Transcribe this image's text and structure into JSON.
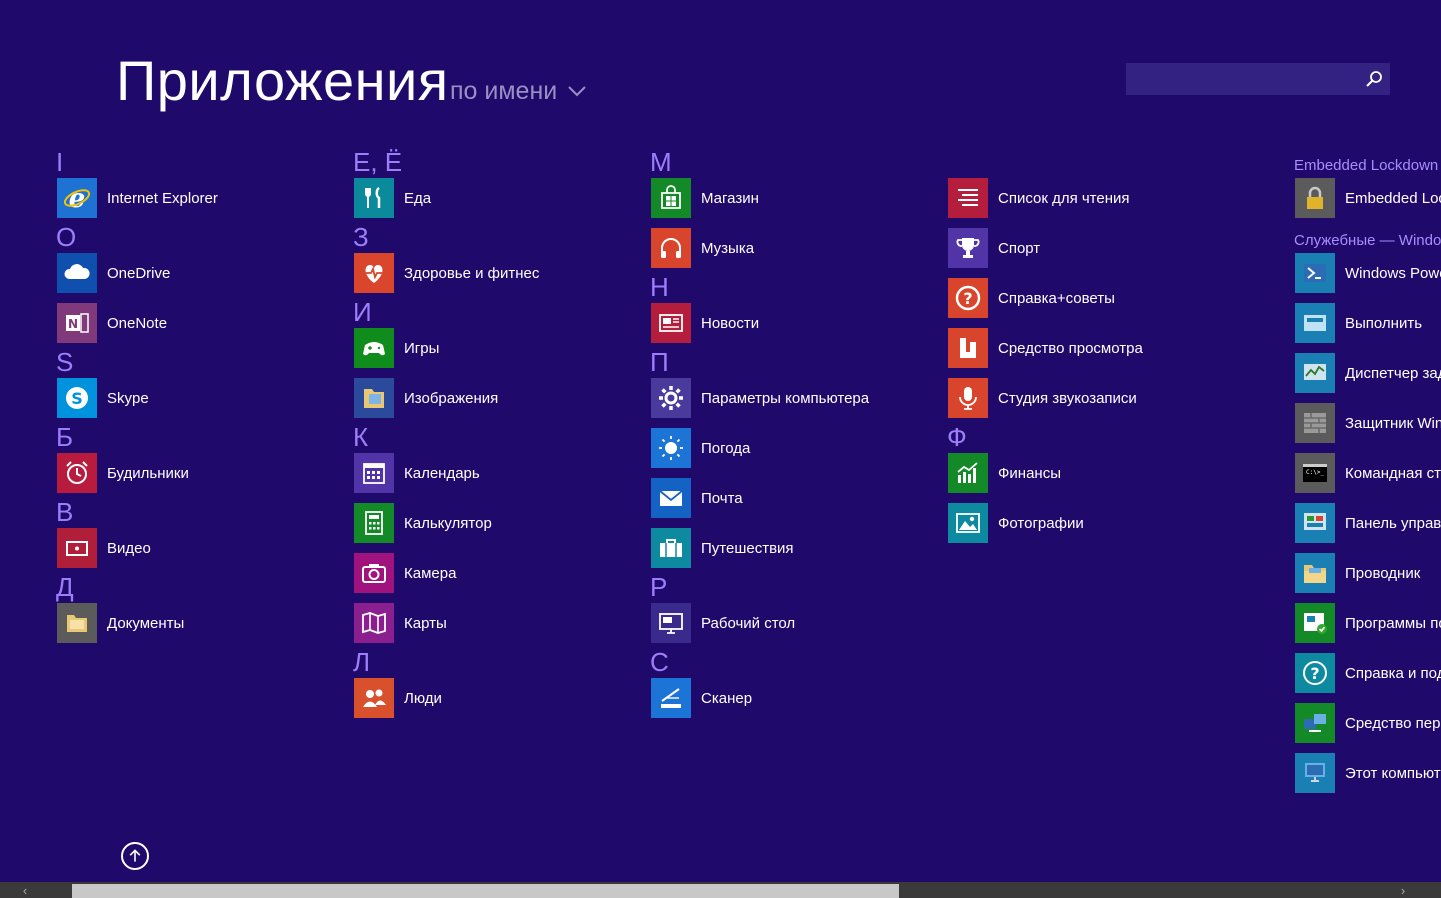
{
  "header": {
    "title": "Приложения",
    "sort_label": "по имени",
    "search_value": ""
  },
  "colors": {
    "background": "#1f0a6b",
    "letter": "#9c7dfa",
    "group_header": "#a98bff"
  },
  "columns": [
    {
      "sections": [
        {
          "letter": "I",
          "apps": [
            {
              "label": "Internet Explorer",
              "icon": "internet-explorer-icon",
              "color": "#1e72d3"
            }
          ]
        },
        {
          "letter": "O",
          "apps": [
            {
              "label": "OneDrive",
              "icon": "cloud-icon",
              "color": "#0f4fae"
            },
            {
              "label": "OneNote",
              "icon": "onenote-icon",
              "color": "#80397b"
            }
          ]
        },
        {
          "letter": "S",
          "apps": [
            {
              "label": "Skype",
              "icon": "skype-icon",
              "color": "#0092dd"
            }
          ]
        },
        {
          "letter": "Б",
          "apps": [
            {
              "label": "Будильники",
              "icon": "alarm-clock-icon",
              "color": "#b81b3e"
            }
          ]
        },
        {
          "letter": "В",
          "apps": [
            {
              "label": "Видео",
              "icon": "video-icon",
              "color": "#b01e3a"
            }
          ]
        },
        {
          "letter": "Д",
          "apps": [
            {
              "label": "Документы",
              "icon": "folder-icon",
              "color": "#5b5b5b"
            }
          ]
        }
      ]
    },
    {
      "sections": [
        {
          "letter": "Е, Ё",
          "apps": [
            {
              "label": "Еда",
              "icon": "fork-knife-icon",
              "color": "#0b8a9c"
            }
          ]
        },
        {
          "letter": "З",
          "apps": [
            {
              "label": "Здоровье и фитнес",
              "icon": "heart-pulse-icon",
              "color": "#d9462c"
            }
          ]
        },
        {
          "letter": "И",
          "apps": [
            {
              "label": "Игры",
              "icon": "gamepad-icon",
              "color": "#108c1c"
            },
            {
              "label": "Изображения",
              "icon": "pictures-folder-icon",
              "color": "#2b4a9c"
            }
          ]
        },
        {
          "letter": "К",
          "apps": [
            {
              "label": "Календарь",
              "icon": "calendar-icon",
              "color": "#5034a8"
            },
            {
              "label": "Калькулятор",
              "icon": "calculator-icon",
              "color": "#138a27"
            },
            {
              "label": "Камера",
              "icon": "camera-icon",
              "color": "#a0127e"
            },
            {
              "label": "Карты",
              "icon": "map-icon",
              "color": "#8b1f8f"
            }
          ]
        },
        {
          "letter": "Л",
          "apps": [
            {
              "label": "Люди",
              "icon": "people-icon",
              "color": "#d9512c"
            }
          ]
        }
      ]
    },
    {
      "sections": [
        {
          "letter": "М",
          "apps": [
            {
              "label": "Магазин",
              "icon": "store-icon",
              "color": "#138a27"
            },
            {
              "label": "Музыка",
              "icon": "headphones-icon",
              "color": "#d9452c"
            }
          ]
        },
        {
          "letter": "Н",
          "apps": [
            {
              "label": "Новости",
              "icon": "news-icon",
              "color": "#b51d3c"
            }
          ]
        },
        {
          "letter": "П",
          "apps": [
            {
              "label": "Параметры компьютера",
              "icon": "gear-icon",
              "color": "#4a3a9c"
            },
            {
              "label": "Погода",
              "icon": "sun-icon",
              "color": "#1b74d6"
            },
            {
              "label": "Почта",
              "icon": "mail-icon",
              "color": "#1463c4"
            },
            {
              "label": "Путешествия",
              "icon": "suitcase-icon",
              "color": "#0e8aa0"
            }
          ]
        },
        {
          "letter": "Р",
          "apps": [
            {
              "label": "Рабочий стол",
              "icon": "desktop-icon",
              "color": "#3a2a8c"
            }
          ]
        },
        {
          "letter": "С",
          "apps": [
            {
              "label": "Сканер",
              "icon": "scanner-icon",
              "color": "#1b74d6"
            }
          ]
        }
      ]
    },
    {
      "sections": [
        {
          "letter": "",
          "apps": [
            {
              "label": "Список для чтения",
              "icon": "reading-list-icon",
              "color": "#b51d3c"
            },
            {
              "label": "Спорт",
              "icon": "trophy-icon",
              "color": "#5034a8"
            },
            {
              "label": "Справка+советы",
              "icon": "help-icon",
              "color": "#d9452c"
            },
            {
              "label": "Средство просмотра",
              "icon": "reader-icon",
              "color": "#d9452c"
            },
            {
              "label": "Студия звукозаписи",
              "icon": "microphone-icon",
              "color": "#d9452c"
            }
          ]
        },
        {
          "letter": "Ф",
          "apps": [
            {
              "label": "Финансы",
              "icon": "finance-chart-icon",
              "color": "#138a27"
            },
            {
              "label": "Фотографии",
              "icon": "photo-icon",
              "color": "#0e8aa0"
            }
          ]
        }
      ]
    },
    {
      "sections": [
        {
          "group": "Embedded Lockdown",
          "apps": [
            {
              "label": "Embedded Loc",
              "icon": "lock-icon",
              "color": "#5b5b5b"
            }
          ]
        },
        {
          "group": "Служебные — Windo",
          "apps": [
            {
              "label": "Windows Powe",
              "icon": "powershell-icon",
              "color": "#1a7fb3"
            },
            {
              "label": "Выполнить",
              "icon": "run-icon",
              "color": "#1a7fb3"
            },
            {
              "label": "Диспетчер зад",
              "icon": "task-manager-icon",
              "color": "#1a7fb3"
            },
            {
              "label": "Защитник Win",
              "icon": "defender-icon",
              "color": "#5b5b5b"
            },
            {
              "label": "Командная стр",
              "icon": "cmd-icon",
              "color": "#5b5b5b"
            },
            {
              "label": "Панель управл",
              "icon": "control-panel-icon",
              "color": "#1a7fb3"
            },
            {
              "label": "Проводник",
              "icon": "explorer-icon",
              "color": "#1a7fb3"
            },
            {
              "label": "Программы по",
              "icon": "default-programs-icon",
              "color": "#138a27"
            },
            {
              "label": "Справка и под",
              "icon": "help-support-icon",
              "color": "#0e8aa0"
            },
            {
              "label": "Средство пере",
              "icon": "transfer-icon",
              "color": "#138a27"
            },
            {
              "label": "Этот компьюте",
              "icon": "computer-icon",
              "color": "#1a7fb3"
            }
          ]
        }
      ]
    }
  ]
}
